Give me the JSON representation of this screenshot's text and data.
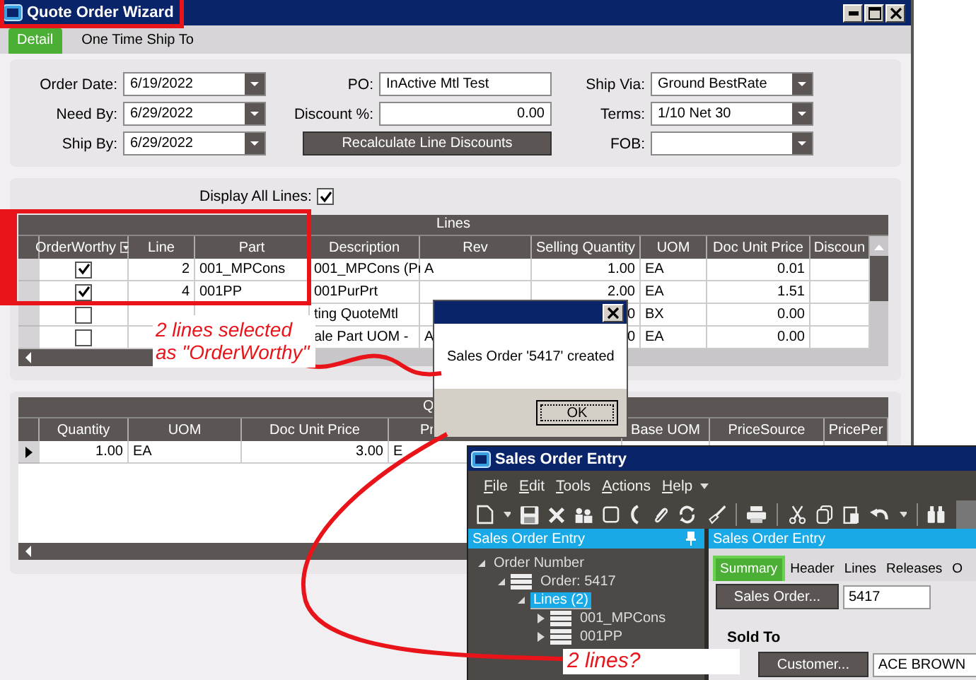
{
  "window": {
    "title": "Quote Order Wizard"
  },
  "tabs": [
    {
      "label": "Detail",
      "selected": true
    },
    {
      "label": "One Time Ship To",
      "selected": false
    }
  ],
  "form": {
    "columns": [
      [
        {
          "kind": "dropdown",
          "label": "Order Date:",
          "value": "6/19/2022"
        },
        {
          "kind": "dropdown",
          "label": "Need By:",
          "value": "6/29/2022"
        },
        {
          "kind": "dropdown",
          "label": "Ship By:",
          "value": "6/29/2022"
        }
      ],
      [
        {
          "kind": "text",
          "label": "PO:",
          "value": "InActive Mtl Test"
        },
        {
          "kind": "number",
          "label": "Discount %:",
          "value": "0.00"
        },
        {
          "kind": "button",
          "label": "Recalculate Line Discounts"
        }
      ],
      [
        {
          "kind": "dropdown",
          "label": "Ship Via:",
          "value": "Ground BestRate"
        },
        {
          "kind": "dropdown",
          "label": "Terms:",
          "value": "1/10 Net 30"
        },
        {
          "kind": "dropdown",
          "label": "FOB:"
        }
      ]
    ]
  },
  "display_all_lines": {
    "label": "Display All Lines:",
    "checked": true
  },
  "lines_grid": {
    "title": "Lines",
    "columns": [
      {
        "label": "OrderWorthy",
        "kind": "check"
      },
      {
        "label": "Line",
        "kind": "number"
      },
      {
        "label": "Part",
        "kind": "text"
      },
      {
        "label": "Description",
        "kind": "text"
      },
      {
        "label": "Rev",
        "kind": "text"
      },
      {
        "label": "Selling Quantity",
        "kind": "number"
      },
      {
        "label": "UOM",
        "kind": "text"
      },
      {
        "label": "Doc Unit Price",
        "kind": "number"
      },
      {
        "label": "Discoun",
        "kind": "text"
      }
    ],
    "rows": [
      {
        "order_worthy": true,
        "cells": [
          null,
          "2",
          "001_MPCons",
          "001_MPCons (Pr",
          "A",
          "1.00",
          "EA",
          "0.01"
        ]
      },
      {
        "order_worthy": true,
        "cells": [
          null,
          "4",
          "001PP",
          "001PurPrt",
          null,
          "2.00",
          "EA",
          "1.51"
        ]
      },
      {
        "order_worthy": false,
        "cells": [
          null,
          null,
          null,
          "ting QuoteMtl",
          null,
          "0",
          "BX",
          "0.00"
        ]
      },
      {
        "order_worthy": false,
        "cells": [
          null,
          null,
          null,
          "ale Part UOM -",
          "A",
          "0",
          "EA",
          "0.00"
        ]
      }
    ]
  },
  "quote_grid": {
    "title": "Q",
    "columns": [
      {
        "label": "Quantity",
        "kind": "number"
      },
      {
        "label": "UOM",
        "kind": "text"
      },
      {
        "label": "Doc Unit Price",
        "kind": "number"
      },
      {
        "label": "Pr",
        "kind": "text"
      },
      {
        "label": "Base UOM",
        "kind": "text"
      },
      {
        "label": "PriceSource",
        "kind": "text"
      },
      {
        "label": "PricePer",
        "kind": "text"
      }
    ],
    "rows": [
      {
        "cells": [
          "1.00",
          "EA",
          "3.00",
          "E"
        ]
      }
    ]
  },
  "dialog": {
    "message": "Sales Order '5417' created",
    "button": "OK"
  },
  "sales_window": {
    "title": "Sales Order Entry",
    "menu": [
      "File",
      "Edit",
      "Tools",
      "Actions",
      "Help"
    ],
    "tree_title": "Sales Order Entry",
    "tree": [
      {
        "label": "Order Number",
        "icon": false,
        "expanded": true,
        "selected": false,
        "children": [
          {
            "label": "Order: 5417",
            "icon": true,
            "expanded": true,
            "selected": false,
            "children": [
              {
                "label": "Lines (2)",
                "icon": false,
                "expanded": true,
                "selected": true,
                "children": [
                  {
                    "label": "001_MPCons",
                    "icon": true,
                    "expanded": false,
                    "selected": false
                  },
                  {
                    "label": "001PP",
                    "icon": true,
                    "expanded": false,
                    "selected": false
                  }
                ]
              }
            ]
          }
        ]
      }
    ],
    "detail_title": "Sales Order Entry",
    "tabs": [
      {
        "label": "Summary",
        "selected": true
      },
      {
        "label": "Header",
        "selected": false
      },
      {
        "label": "Lines",
        "selected": false
      },
      {
        "label": "Releases",
        "selected": false
      },
      {
        "label": "O",
        "selected": false
      }
    ],
    "sales_order_button": "Sales Order...",
    "sales_order_value": "5417",
    "sold_to_label": "Sold To",
    "customer_button": "Customer...",
    "customer_value": "ACE BROWN"
  },
  "annotations": [
    {
      "text": "2 lines selected\nas \"OrderWorthy\""
    },
    {
      "text": "2 lines?"
    }
  ]
}
